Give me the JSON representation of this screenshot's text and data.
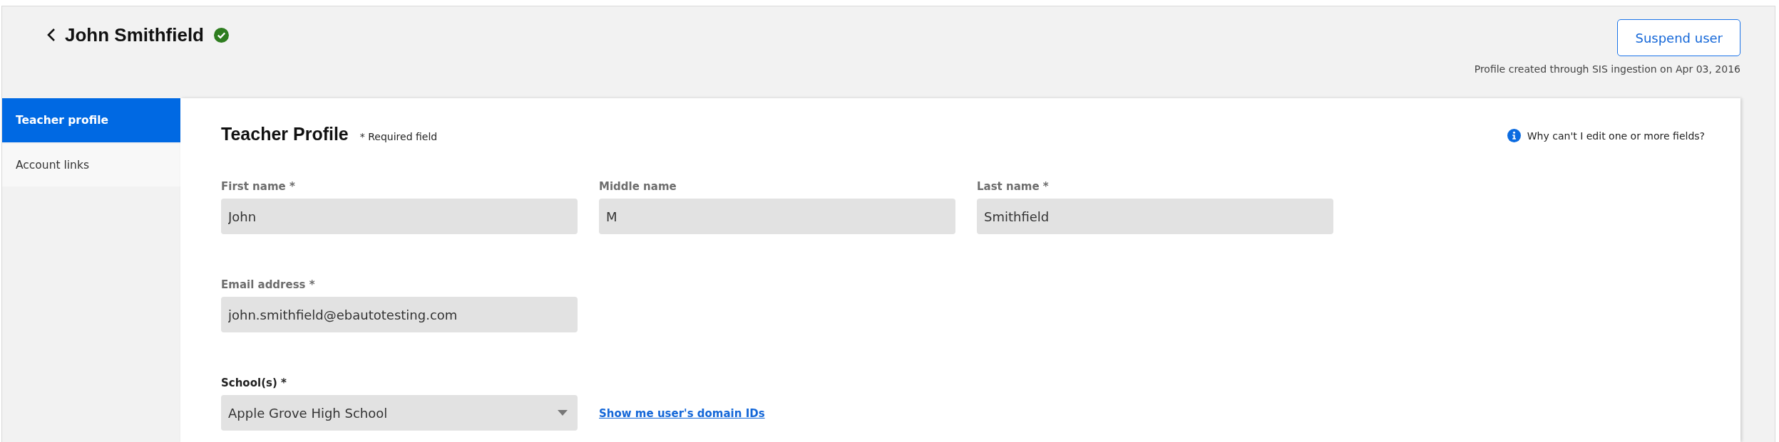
{
  "header": {
    "title": "John Smithfield",
    "verified": true,
    "action_button": "Suspend user",
    "created_note": "Profile created through SIS ingestion on Apr 03, 2016"
  },
  "sidebar": {
    "items": [
      {
        "label": "Teacher profile",
        "selected": true
      },
      {
        "label": "Account links",
        "selected": false
      }
    ]
  },
  "form": {
    "title": "Teacher Profile",
    "required_note": "* Required field",
    "help_link": "Why can't I edit one or more fields?",
    "rows": [
      {
        "fields": [
          {
            "kind": "text",
            "label": "First name *",
            "value": "John"
          },
          {
            "kind": "text",
            "label": "Middle name",
            "value": "M"
          },
          {
            "kind": "text",
            "label": "Last name *",
            "value": "Smithfield"
          }
        ]
      },
      {
        "fields": [
          {
            "kind": "text",
            "label": "Email address *",
            "value": "john.smithfield@ebautotesting.com"
          }
        ]
      },
      {
        "fields": [
          {
            "kind": "select",
            "label": "School(s) *",
            "value": "Apple Grove High School"
          }
        ],
        "link": "Show me user's domain IDs"
      }
    ]
  }
}
